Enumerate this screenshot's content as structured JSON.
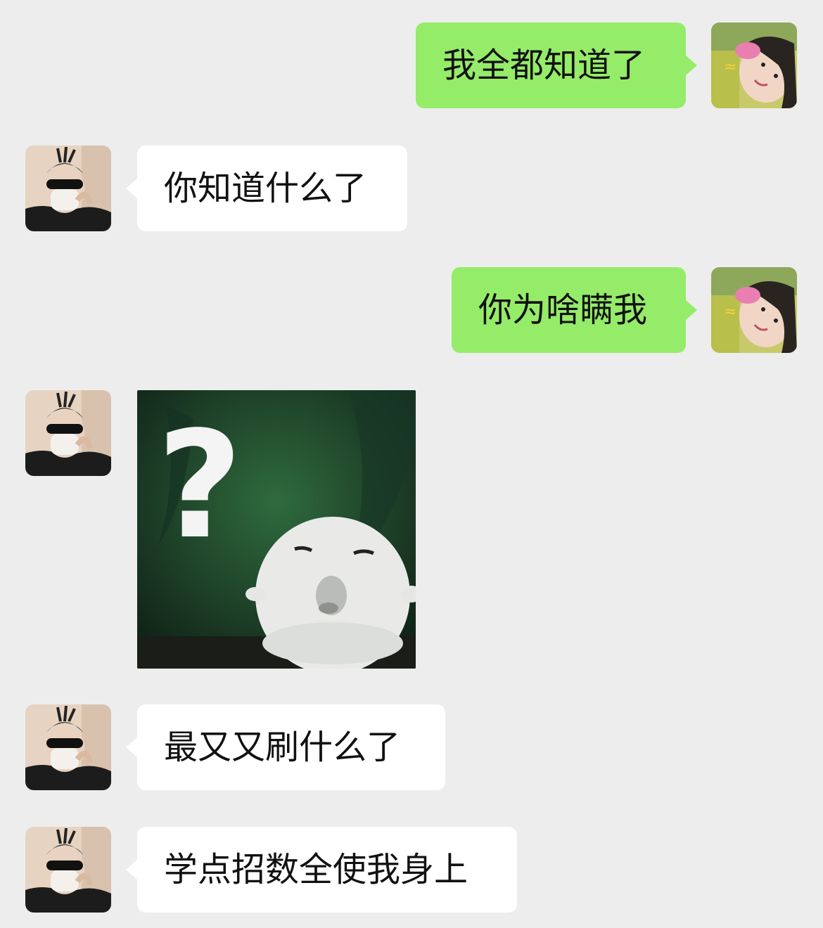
{
  "chat": {
    "background": "#ededed",
    "sent_bubble_color": "#95ec69",
    "received_bubble_color": "#ffffff",
    "messages": [
      {
        "side": "sent",
        "type": "text",
        "text": "我全都知道了"
      },
      {
        "side": "received",
        "type": "text",
        "text": "你知道什么了"
      },
      {
        "side": "sent",
        "type": "text",
        "text": "你为啥瞒我"
      },
      {
        "side": "received",
        "type": "sticker",
        "sticker": "question-mark-ghost-sticker",
        "text": "?"
      },
      {
        "side": "received",
        "type": "text",
        "text": "最又又刷什么了"
      },
      {
        "side": "received",
        "type": "text",
        "text": "学点招数全使我身上"
      }
    ]
  }
}
